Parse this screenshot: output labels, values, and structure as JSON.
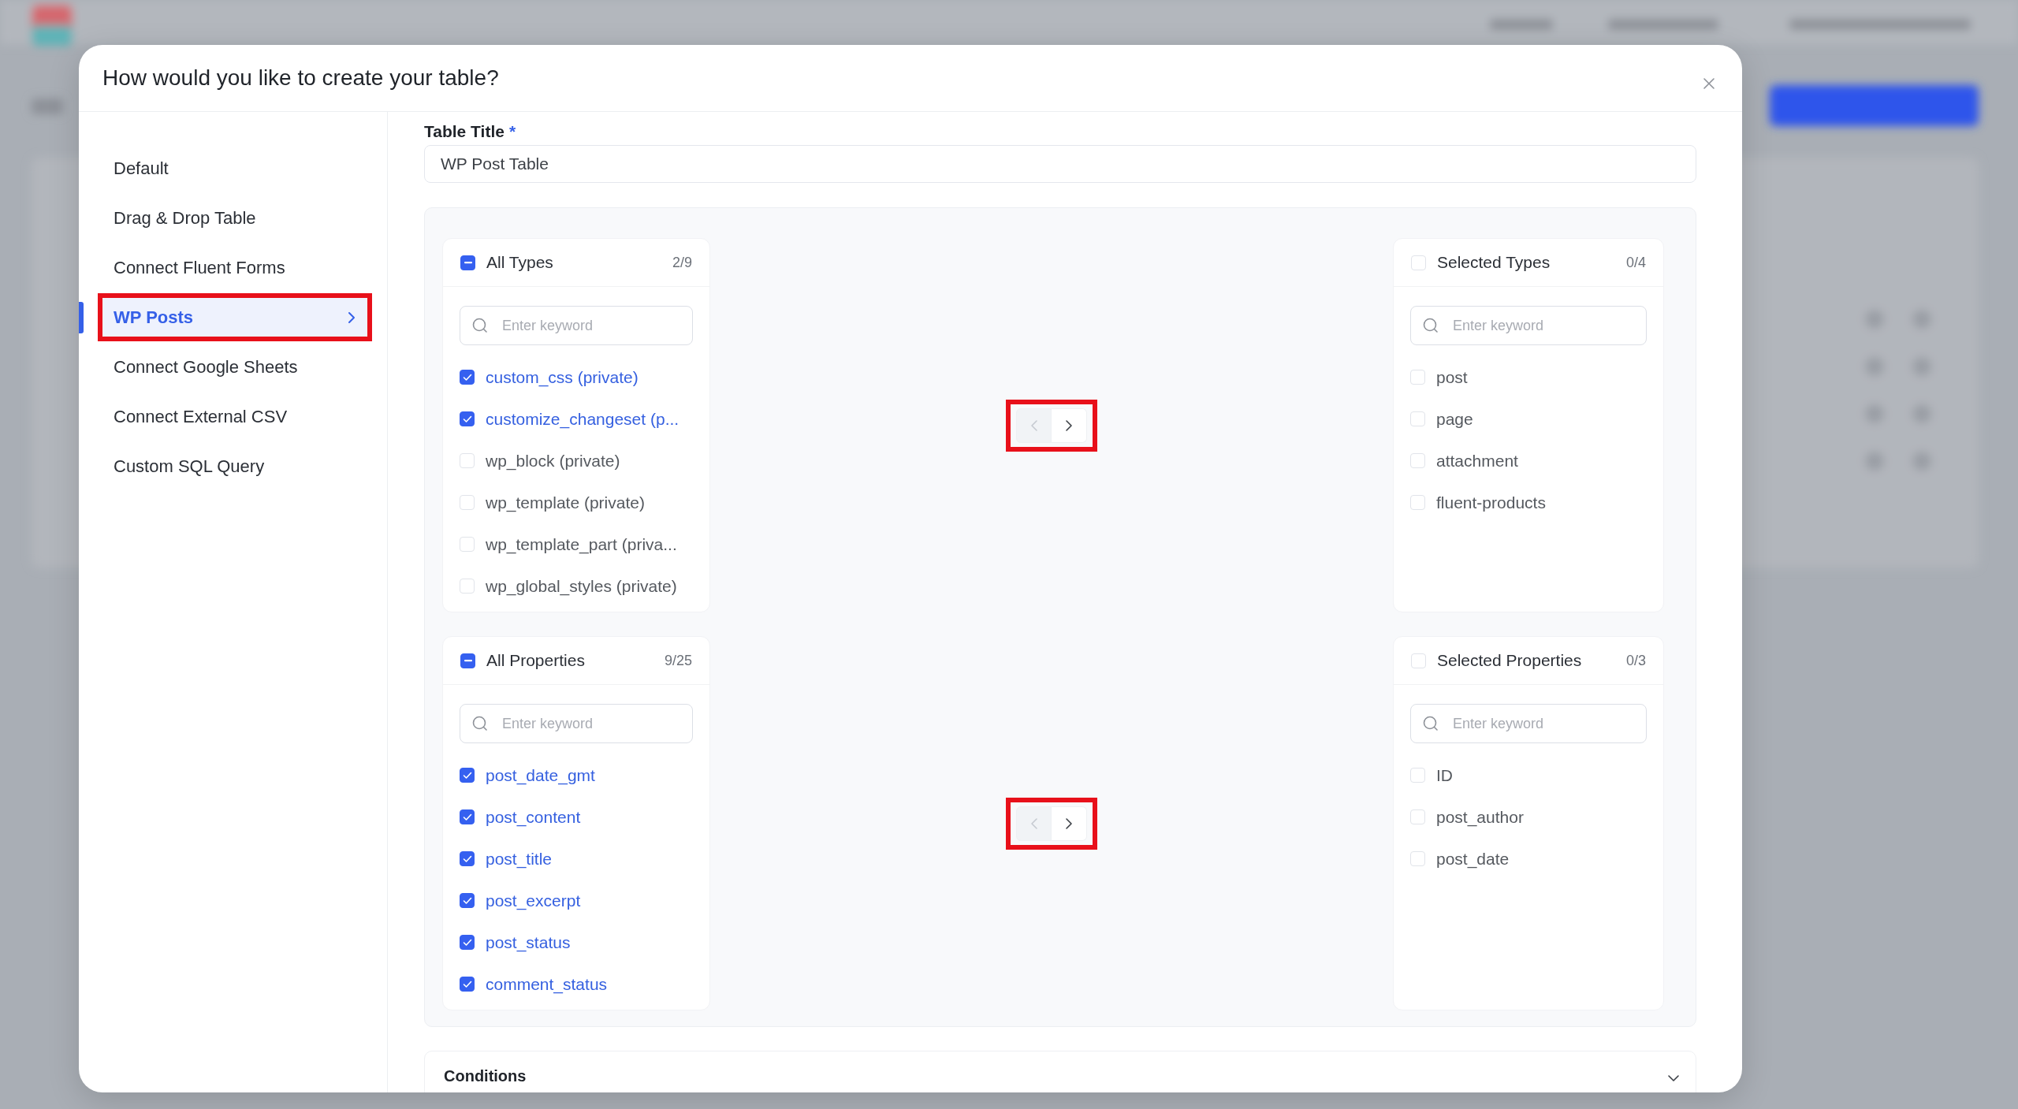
{
  "dialog": {
    "title": "How would you like to create your table?"
  },
  "sidebar": {
    "items": [
      {
        "label": "Default",
        "selected": false,
        "highlighted": false
      },
      {
        "label": "Drag & Drop Table",
        "selected": false,
        "highlighted": false
      },
      {
        "label": "Connect Fluent Forms",
        "selected": false,
        "highlighted": false
      },
      {
        "label": "WP Posts",
        "selected": true,
        "highlighted": true
      },
      {
        "label": "Connect Google Sheets",
        "selected": false,
        "highlighted": false
      },
      {
        "label": "Connect External CSV",
        "selected": false,
        "highlighted": false
      },
      {
        "label": "Custom SQL Query",
        "selected": false,
        "highlighted": false
      }
    ]
  },
  "table_title": {
    "label": "Table Title",
    "required_mark": "*",
    "value": "WP Post Table"
  },
  "transfers": [
    {
      "source": {
        "title": "All Types",
        "count": "2/9",
        "indeterminate": true,
        "placeholder": "Enter keyword",
        "items": [
          {
            "label": "custom_css (private)",
            "checked": true
          },
          {
            "label": "customize_changeset (p...",
            "checked": true
          },
          {
            "label": "wp_block (private)",
            "checked": false
          },
          {
            "label": "wp_template (private)",
            "checked": false
          },
          {
            "label": "wp_template_part (priva...",
            "checked": false
          },
          {
            "label": "wp_global_styles (private)",
            "checked": false
          }
        ]
      },
      "buttons": {
        "prev_disabled": true,
        "next_disabled": false,
        "highlighted": true
      },
      "target": {
        "title": "Selected Types",
        "count": "0/4",
        "checked": false,
        "indeterminate": false,
        "placeholder": "Enter keyword",
        "items": [
          {
            "label": "post",
            "checked": false
          },
          {
            "label": "page",
            "checked": false
          },
          {
            "label": "attachment",
            "checked": false
          },
          {
            "label": "fluent-products",
            "checked": false
          }
        ]
      }
    },
    {
      "source": {
        "title": "All Properties",
        "count": "9/25",
        "indeterminate": true,
        "placeholder": "Enter keyword",
        "items": [
          {
            "label": "post_date_gmt",
            "checked": true
          },
          {
            "label": "post_content",
            "checked": true
          },
          {
            "label": "post_title",
            "checked": true
          },
          {
            "label": "post_excerpt",
            "checked": true
          },
          {
            "label": "post_status",
            "checked": true
          },
          {
            "label": "comment_status",
            "checked": true
          }
        ]
      },
      "buttons": {
        "prev_disabled": true,
        "next_disabled": false,
        "highlighted": true
      },
      "target": {
        "title": "Selected Properties",
        "count": "0/3",
        "checked": false,
        "indeterminate": false,
        "placeholder": "Enter keyword",
        "items": [
          {
            "label": "ID",
            "checked": false
          },
          {
            "label": "post_author",
            "checked": false
          },
          {
            "label": "post_date",
            "checked": false
          }
        ]
      }
    }
  ],
  "conditions": {
    "title": "Conditions",
    "expanded": false
  }
}
